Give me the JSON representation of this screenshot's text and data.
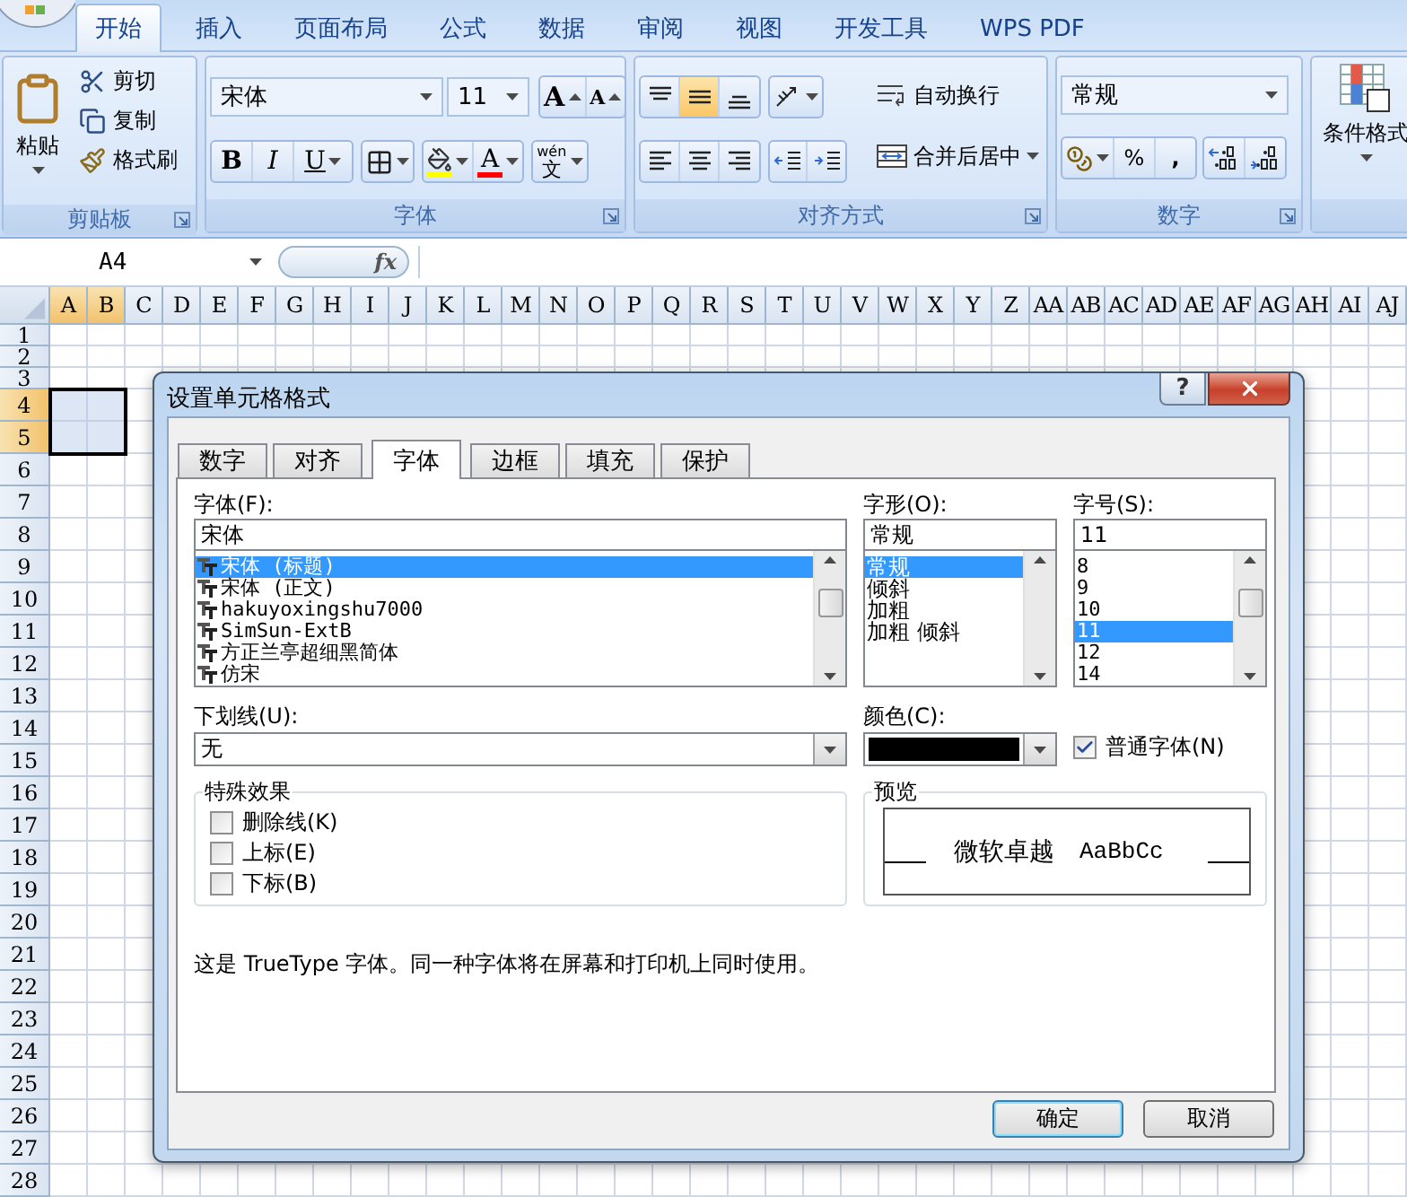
{
  "ribbon_tabs": [
    {
      "label": "开始",
      "selected": true
    },
    {
      "label": "插入",
      "selected": false
    },
    {
      "label": "页面布局",
      "selected": false
    },
    {
      "label": "公式",
      "selected": false
    },
    {
      "label": "数据",
      "selected": false
    },
    {
      "label": "审阅",
      "selected": false
    },
    {
      "label": "视图",
      "selected": false
    },
    {
      "label": "开发工具",
      "selected": false
    },
    {
      "label": "WPS PDF",
      "selected": false
    }
  ],
  "clipboard": {
    "title": "剪贴板",
    "paste": "粘贴",
    "actions": [
      {
        "kind": "cut",
        "label": "剪切"
      },
      {
        "kind": "copy",
        "label": "复制"
      },
      {
        "kind": "brush",
        "label": "格式刷"
      }
    ]
  },
  "font_group": {
    "title": "字体",
    "font_name": "宋体",
    "font_size": "11",
    "grow": "A",
    "shrink": "A",
    "bold": "B",
    "italic": "I",
    "underline": "U",
    "font_color": "A",
    "pinyin": "wén",
    "phonetic": "文"
  },
  "alignment": {
    "title": "对齐方式",
    "wrap_text": "自动换行",
    "merge_center": "合并后居中",
    "vertical": [
      {
        "kind": "top",
        "selected": false
      },
      {
        "kind": "middle",
        "selected": true
      },
      {
        "kind": "bottom",
        "selected": false
      }
    ],
    "horizontal": [
      {
        "kind": "left",
        "selected": false
      },
      {
        "kind": "center",
        "selected": false
      },
      {
        "kind": "right",
        "selected": false
      }
    ]
  },
  "number": {
    "title": "数字",
    "format": "常规",
    "percent": "%",
    "comma": ","
  },
  "styles": {
    "conditional_format": "条件格式"
  },
  "formula_bar": {
    "name_box": "A4",
    "fx": "fx"
  },
  "columns": [
    {
      "label": "A",
      "selected": true
    },
    {
      "label": "B",
      "selected": true
    },
    {
      "label": "C",
      "selected": false
    },
    {
      "label": "D",
      "selected": false
    },
    {
      "label": "E",
      "selected": false
    },
    {
      "label": "F",
      "selected": false
    },
    {
      "label": "G",
      "selected": false
    },
    {
      "label": "H",
      "selected": false
    },
    {
      "label": "I",
      "selected": false
    },
    {
      "label": "J",
      "selected": false
    },
    {
      "label": "K",
      "selected": false
    },
    {
      "label": "L",
      "selected": false
    },
    {
      "label": "M",
      "selected": false
    },
    {
      "label": "N",
      "selected": false
    },
    {
      "label": "O",
      "selected": false
    },
    {
      "label": "P",
      "selected": false
    },
    {
      "label": "Q",
      "selected": false
    },
    {
      "label": "R",
      "selected": false
    },
    {
      "label": "S",
      "selected": false
    },
    {
      "label": "T",
      "selected": false
    },
    {
      "label": "U",
      "selected": false
    },
    {
      "label": "V",
      "selected": false
    },
    {
      "label": "W",
      "selected": false
    },
    {
      "label": "X",
      "selected": false
    },
    {
      "label": "Y",
      "selected": false
    },
    {
      "label": "Z",
      "selected": false
    },
    {
      "label": "AA",
      "selected": false
    },
    {
      "label": "AB",
      "selected": false
    },
    {
      "label": "AC",
      "selected": false
    },
    {
      "label": "AD",
      "selected": false
    },
    {
      "label": "AE",
      "selected": false
    },
    {
      "label": "AF",
      "selected": false
    },
    {
      "label": "AG",
      "selected": false
    },
    {
      "label": "AH",
      "selected": false
    },
    {
      "label": "AI",
      "selected": false
    },
    {
      "label": "AJ",
      "selected": false
    }
  ],
  "rows": [
    {
      "label": "1",
      "selected": false
    },
    {
      "label": "2",
      "selected": false
    },
    {
      "label": "3",
      "selected": false
    },
    {
      "label": "4",
      "selected": true
    },
    {
      "label": "5",
      "selected": true
    },
    {
      "label": "6",
      "selected": false
    },
    {
      "label": "7",
      "selected": false
    },
    {
      "label": "8",
      "selected": false
    },
    {
      "label": "9",
      "selected": false
    },
    {
      "label": "10",
      "selected": false
    },
    {
      "label": "11",
      "selected": false
    },
    {
      "label": "12",
      "selected": false
    },
    {
      "label": "13",
      "selected": false
    },
    {
      "label": "14",
      "selected": false
    },
    {
      "label": "15",
      "selected": false
    },
    {
      "label": "16",
      "selected": false
    },
    {
      "label": "17",
      "selected": false
    },
    {
      "label": "18",
      "selected": false
    },
    {
      "label": "19",
      "selected": false
    },
    {
      "label": "20",
      "selected": false
    },
    {
      "label": "21",
      "selected": false
    },
    {
      "label": "22",
      "selected": false
    },
    {
      "label": "23",
      "selected": false
    },
    {
      "label": "24",
      "selected": false
    },
    {
      "label": "25",
      "selected": false
    },
    {
      "label": "26",
      "selected": false
    },
    {
      "label": "27",
      "selected": false
    },
    {
      "label": "28",
      "selected": false
    }
  ],
  "dialog": {
    "title": "设置单元格格式",
    "help": "?",
    "tabs": [
      {
        "label": "数字",
        "selected": false
      },
      {
        "label": "对齐",
        "selected": false
      },
      {
        "label": "字体",
        "selected": true
      },
      {
        "label": "边框",
        "selected": false
      },
      {
        "label": "填充",
        "selected": false
      },
      {
        "label": "保护",
        "selected": false
      }
    ],
    "font": {
      "label": "字体(F):",
      "value": "宋体",
      "options": [
        {
          "label": "宋体 (标题)",
          "selected": true
        },
        {
          "label": "宋体 (正文)",
          "selected": false
        },
        {
          "label": "hakuyoxingshu7000",
          "selected": false
        },
        {
          "label": "SimSun-ExtB",
          "selected": false
        },
        {
          "label": "方正兰亭超细黑简体",
          "selected": false
        },
        {
          "label": "仿宋",
          "selected": false
        }
      ]
    },
    "style": {
      "label": "字形(O):",
      "value": "常规",
      "options": [
        {
          "label": "常规",
          "selected": true
        },
        {
          "label": "倾斜",
          "selected": false
        },
        {
          "label": "加粗",
          "selected": false
        },
        {
          "label": "加粗 倾斜",
          "selected": false
        }
      ]
    },
    "size": {
      "label": "字号(S):",
      "value": "11",
      "options": [
        {
          "label": "8",
          "selected": false
        },
        {
          "label": "9",
          "selected": false
        },
        {
          "label": "10",
          "selected": false
        },
        {
          "label": "11",
          "selected": true
        },
        {
          "label": "12",
          "selected": false
        },
        {
          "label": "14",
          "selected": false
        }
      ]
    },
    "underline": {
      "label": "下划线(U):",
      "value": "无"
    },
    "color": {
      "label": "颜色(C):",
      "color": "#000000"
    },
    "normal_font": {
      "label": "普通字体(N)",
      "checked": true
    },
    "effects": {
      "title": "特殊效果",
      "options": [
        {
          "label": "删除线(K)",
          "checked": false
        },
        {
          "label": "上标(E)",
          "checked": false
        },
        {
          "label": "下标(B)",
          "checked": false
        }
      ]
    },
    "preview": {
      "title": "预览",
      "sample_cjk": "微软卓越",
      "sample_latin": "AaBbCc"
    },
    "description": "这是 TrueType 字体。同一种字体将在屏幕和打印机上同时使用。",
    "buttons": [
      {
        "label": "确定",
        "default": true
      },
      {
        "label": "取消",
        "default": false
      }
    ]
  }
}
